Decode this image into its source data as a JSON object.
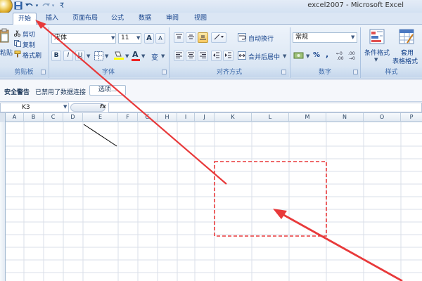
{
  "window": {
    "title": "excel2007 - Microsoft Excel"
  },
  "quick_access": {
    "save_icon": "save-icon",
    "undo_icon": "undo-icon",
    "redo_icon": "redo-icon",
    "customize": "₹"
  },
  "tabs": [
    "开始",
    "插入",
    "页面布局",
    "公式",
    "数据",
    "审阅",
    "视图"
  ],
  "ribbon": {
    "clipboard": {
      "paste": "粘贴",
      "cut": "剪切",
      "copy": "复制",
      "format_painter": "格式刷",
      "label": "剪贴板"
    },
    "font": {
      "name": "宋体",
      "size": "11",
      "bold": "B",
      "italic": "I",
      "underline": "U",
      "grow": "A",
      "shrink": "A",
      "label": "字体",
      "fill_letter": "A",
      "color_letter": "A",
      "phonetic": "变"
    },
    "alignment": {
      "wrap": "自动换行",
      "merge": "合并后居中",
      "label": "对齐方式"
    },
    "number": {
      "format": "常规",
      "percent": "%",
      "comma": ",",
      "label": "数字"
    },
    "styles": {
      "conditional": "条件格式",
      "table_line1": "套用",
      "table_line2": "表格格式",
      "label": "样式"
    }
  },
  "security_bar": {
    "title": "安全警告",
    "message": "已禁用了数据连接",
    "options_button": "选项..."
  },
  "formula_bar": {
    "name_box": "K3",
    "fx": "fx"
  },
  "columns": [
    "A",
    "B",
    "C",
    "D",
    "E",
    "F",
    "G",
    "H",
    "I",
    "J",
    "K",
    "L",
    "M",
    "N",
    "O",
    "P"
  ],
  "colors": {
    "annotation": "#e8393a"
  }
}
